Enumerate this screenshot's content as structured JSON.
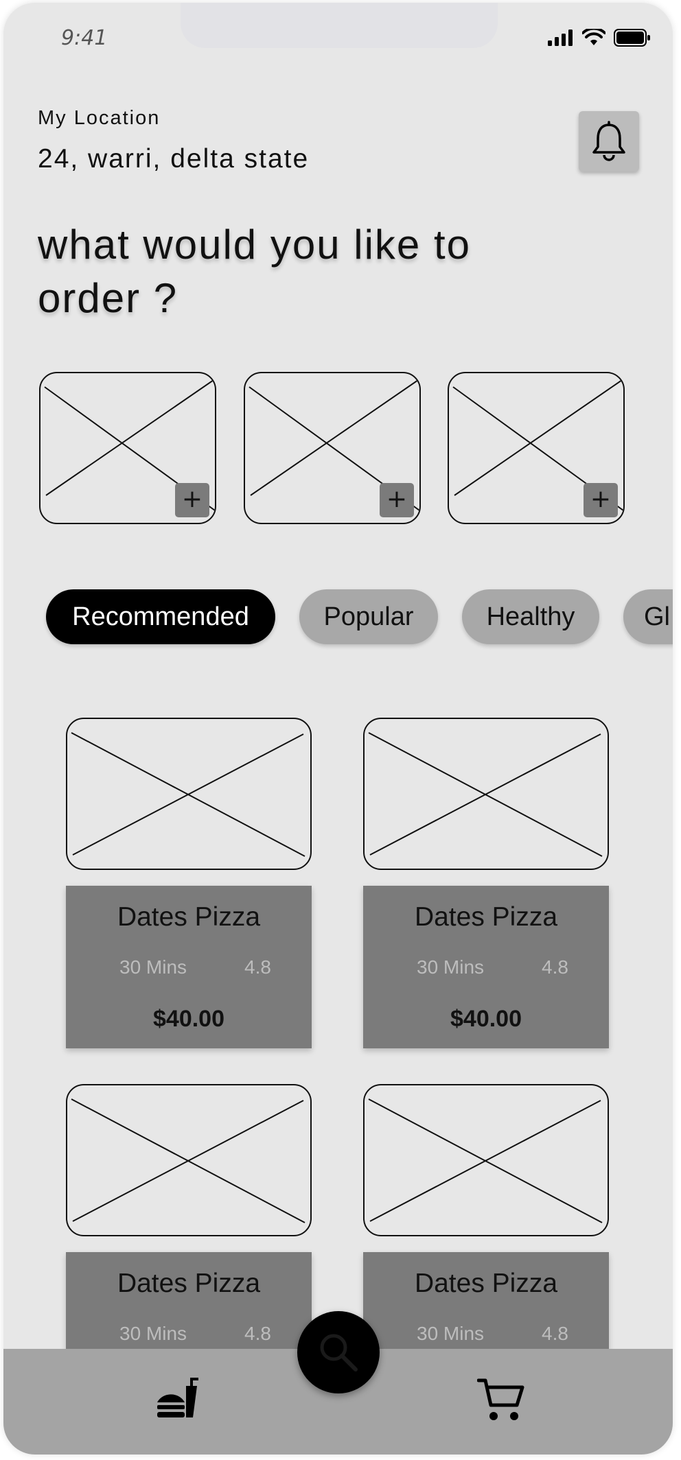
{
  "status_bar": {
    "time": "9:41"
  },
  "location": {
    "label": "My Location",
    "value": "24, warri, delta state"
  },
  "headline": "what would you like to order ?",
  "category_cards": [
    {
      "add_label": "+"
    },
    {
      "add_label": "+"
    },
    {
      "add_label": "+"
    }
  ],
  "filters": [
    {
      "label": "Recommended",
      "active": true
    },
    {
      "label": "Popular",
      "active": false
    },
    {
      "label": "Healthy",
      "active": false
    },
    {
      "label": "Gl",
      "active": false
    }
  ],
  "products": [
    {
      "name": "Dates Pizza",
      "time": "30 Mins",
      "rating": "4.8",
      "price": "$40.00"
    },
    {
      "name": "Dates Pizza",
      "time": "30 Mins",
      "rating": "4.8",
      "price": "$40.00"
    },
    {
      "name": "Dates Pizza",
      "time": "30 Mins",
      "rating": "4.8",
      "price": ""
    },
    {
      "name": "Dates Pizza",
      "time": "30 Mins",
      "rating": "4.8",
      "price": ""
    }
  ],
  "bottom_nav": {
    "items": [
      {
        "icon": "food-icon"
      },
      {
        "icon": "search-icon"
      },
      {
        "icon": "cart-icon"
      }
    ]
  },
  "colors": {
    "background": "#e7e7e7",
    "card_info": "#7b7b7b",
    "chip": "#a8a8a8",
    "chip_active": "#000000",
    "bottom_bar": "#a4a4a4"
  }
}
